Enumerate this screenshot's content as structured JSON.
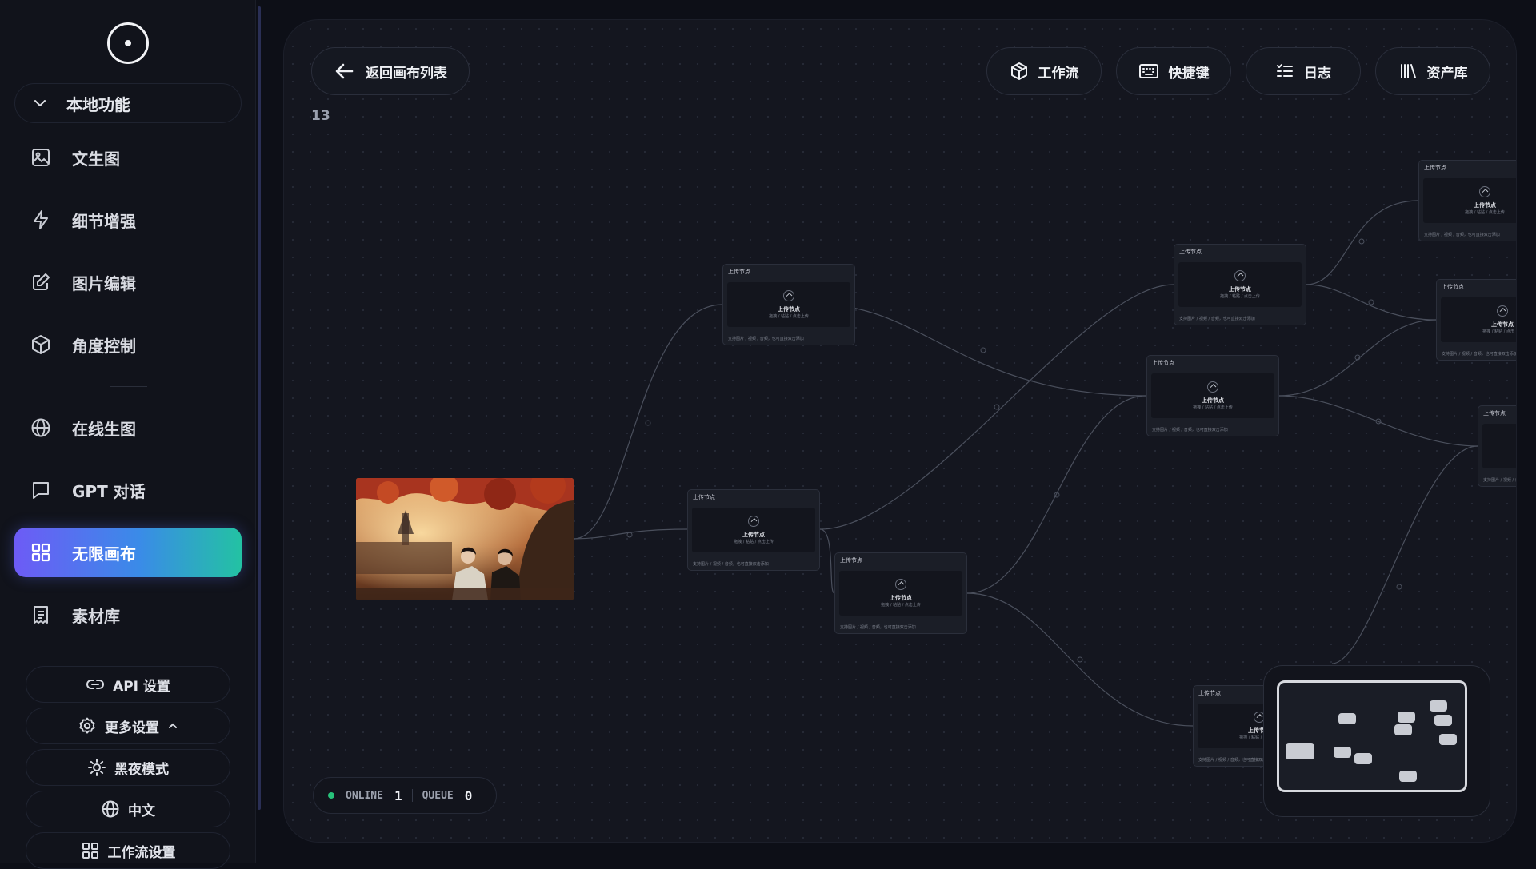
{
  "sidebar": {
    "section_label": "本地功能",
    "items": [
      {
        "label": "文生图",
        "icon": "image-icon"
      },
      {
        "label": "细节增强",
        "icon": "lightning-icon"
      },
      {
        "label": "图片编辑",
        "icon": "edit-icon"
      },
      {
        "label": "角度控制",
        "icon": "cube-icon"
      },
      {
        "label": "在线生图",
        "icon": "globe-icon"
      },
      {
        "label": "GPT 对话",
        "icon": "chat-icon"
      },
      {
        "label": "无限画布",
        "icon": "grid-icon",
        "active": true
      },
      {
        "label": "素材库",
        "icon": "document-icon"
      }
    ],
    "bottom": {
      "api_label": "API 设置",
      "more_label": "更多设置",
      "dark_label": "黑夜模式",
      "lang_label": "中文",
      "workflow_label": "工作流设置"
    }
  },
  "toolbar": {
    "back_label": "返回画布列表",
    "workflow_label": "工作流",
    "shortcuts_label": "快捷键",
    "log_label": "日志",
    "assets_label": "资产库"
  },
  "canvas": {
    "counter": "13",
    "node_title": "上传节点",
    "node_label": "上传节点",
    "node_sub": "拖拽 / 粘贴 / 点击上传",
    "node_foot": "支持图片 / 视频 / 音频，也可直接双击添加",
    "image_alt": "two figures under red maple tree"
  },
  "status": {
    "online_label": "ONLINE",
    "online_count": "1",
    "queue_label": "QUEUE",
    "queue_count": "0"
  },
  "colors": {
    "accent_start": "#6d5bf6",
    "accent_mid": "#3a8be8",
    "accent_end": "#23c2a3",
    "online": "#27c27a"
  }
}
